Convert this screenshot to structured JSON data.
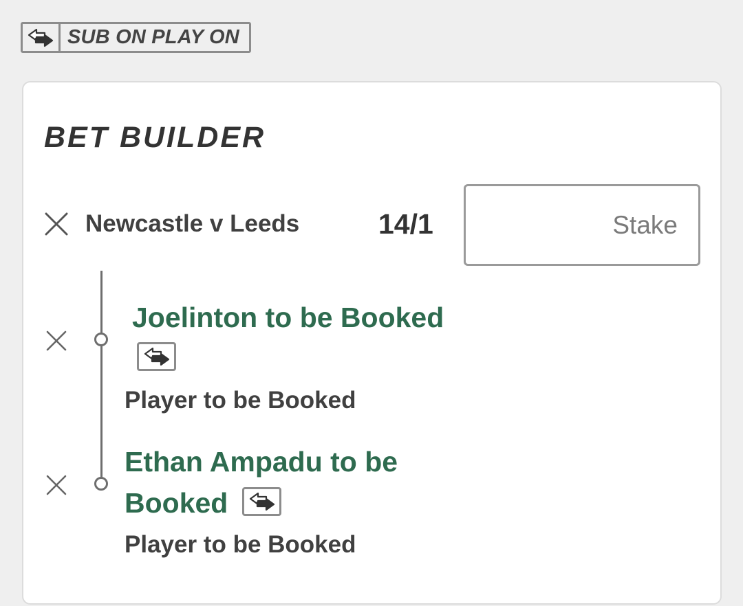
{
  "sub_badge": {
    "label": "SUB ON PLAY ON",
    "icon": "substitution-arrows-icon"
  },
  "bet_builder": {
    "title": "BET BUILDER",
    "match": "Newcastle v Leeds",
    "odds": "14/1",
    "stake_placeholder": "Stake",
    "selections": [
      {
        "title": "Joelinton to be Booked",
        "market": "Player to be Booked",
        "sub_icon": "substitution-arrows-icon"
      },
      {
        "title_line1": "Ethan Ampadu to be",
        "title_line2": "Booked",
        "market": "Player to be Booked",
        "sub_icon": "substitution-arrows-icon"
      }
    ]
  },
  "colors": {
    "background": "#efefef",
    "card": "#ffffff",
    "selection_green": "#2e6b4f",
    "text_dark": "#3b3b3b",
    "border_gray": "#8c8c8c"
  }
}
